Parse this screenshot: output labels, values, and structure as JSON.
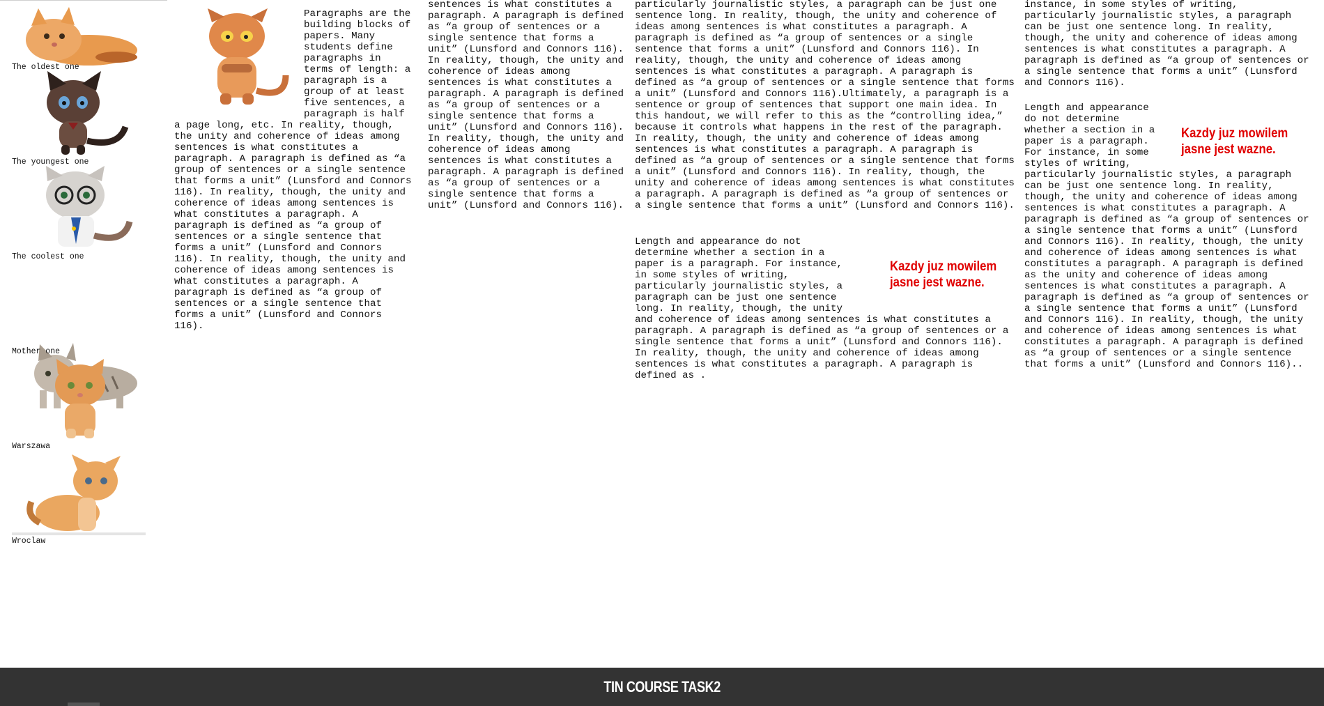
{
  "sidebar": {
    "items": [
      {
        "caption": "The oldest one",
        "colors": {
          "fur": "#e89a4e",
          "dark": "#b9652a"
        }
      },
      {
        "caption": "The youngest one",
        "colors": {
          "fur": "#5a4036",
          "dark": "#2e211c"
        }
      },
      {
        "caption": "The coolest one",
        "colors": {
          "fur": "#d6d3cf",
          "dark": "#2a5aa8"
        }
      },
      {
        "caption": "Mother one",
        "colors": {
          "fur": "#b8ada0",
          "dark": "#6f6458"
        }
      },
      {
        "caption": "Warszawa",
        "colors": {
          "fur": "#e39a55",
          "dark": "#c06a2b"
        }
      },
      {
        "caption": "Wroclaw",
        "colors": {
          "fur": "#eaa760",
          "dark": "#c17a3a"
        }
      }
    ]
  },
  "columns": {
    "col1_text": "Paragraphs are the building blocks of papers. Many students define paragraphs in terms of length: a paragraph is a group of at least five sentences, a paragraph is half a page long, etc. In reality, though, the unity and coherence of ideas among sentences is what constitutes a paragraph. A paragraph is defined as “a group of sentences or a single sentence that forms a unit” (Lunsford and Connors 116). In reality, though, the unity and coherence of ideas among sentences is what constitutes a paragraph. A paragraph is defined as “a group of sentences or a single sentence that forms a unit” (Lunsford and Connors 116). In reality, though, the unity and coherence of ideas among sentences is what constitutes a paragraph. A paragraph is defined as “a group of sentences or a single sentence that forms a unit” (Lunsford and Connors 116).",
    "col2_text": "sentences is what constitutes a paragraph. A paragraph is defined as “a group of sentences or a single sentence that forms a unit” (Lunsford and Connors 116). In reality, though, the unity and coherence of ideas among sentences is what constitutes a paragraph. A paragraph is defined as “a group of sentences or a single sentence that forms a unit” (Lunsford and Connors 116). In reality, though, the unity and coherence of ideas among sentences is what constitutes a paragraph. A paragraph is defined as “a group of sentences or a single sentence that forms a unit” (Lunsford and Connors 116).",
    "col3_text": "particularly journalistic styles, a paragraph can be just one sentence long. In reality, though, the unity and coherence of ideas among sentences is what constitutes a paragraph. A paragraph is defined as “a group of sentences or a single sentence that forms a unit” (Lunsford and Connors 116). In reality, though, the unity and coherence of ideas among sentences is what constitutes a paragraph. A paragraph is defined as “a group of sentences or a single sentence that forms a unit” (Lunsford and Connors 116).Ultimately, a paragraph is a sentence or group of sentences that support one main idea. In this handout, we will refer to this as the “controlling idea,” because it controls what happens in the rest of the paragraph. In reality, though, the unity and coherence of ideas among sentences is what constitutes a paragraph. A paragraph is defined as “a group of sentences or a single sentence that forms a unit” (Lunsford and Connors 116). In reality, though, the unity and coherence of ideas among sentences is what constitutes a paragraph. A paragraph is defined as “a group of sentences or a single sentence that forms a unit” (Lunsford and Connors 116).",
    "col3_text2_wrap": "Length and appearance do not determine whether a section in a paper is a paragraph. For instance, in some styles of writing, particularly journalistic styles, a paragraph can be just one sentence long. In reality, though, the unity",
    "col3_text2_rest": "and coherence of ideas among sentences is what constitutes a paragraph. A paragraph is defined as “a group of sentences or a single sentence that forms a unit” (Lunsford and Connors 116). In reality, though, the unity and coherence of ideas among sentences is what constitutes a paragraph. A paragraph is defined as .",
    "col4_text": "instance, in some styles of writing, particularly journalistic styles, a paragraph can be just one sentence long. In reality, though, the unity and coherence of ideas among sentences is what constitutes a paragraph. A paragraph is defined as “a group of sentences or a single sentence that forms a unit” (Lunsford and Connors 116).",
    "col4_text2_wrap": "Length and appearance do not determine whether a section in a paper is a paragraph. For instance, in some styles of writing,",
    "col4_text2_rest": "particularly journalistic styles, a paragraph can be just one sentence long. In reality, though, the unity and coherence of ideas among sentences is what constitutes a paragraph. A paragraph is defined as “a group of sentences or a single sentence that forms a unit” (Lunsford and Connors 116). In reality, though, the unity and coherence of ideas among sentences is what constitutes a paragraph. A paragraph is defined as the unity and coherence of ideas among sentences is what constitutes a paragraph. A paragraph is defined as “a group of sentences or a single sentence that forms a unit” (Lunsford and Connors 116). In reality, though, the unity and coherence of ideas among sentences is what constitutes a paragraph. A paragraph is defined as “a group of sentences or a single sentence that forms a unit” (Lunsford and Connors 116)..",
    "red_note_1": "Kazdy juz mowilem\njasne jest wazne.",
    "red_note_2": "Kazdy juz mowilem\njasne jest wazne."
  },
  "footer": {
    "title": "TIN COURSE TASK2",
    "background": "#333333"
  },
  "colors": {
    "accent_red": "#e00000",
    "text": "#111111"
  }
}
